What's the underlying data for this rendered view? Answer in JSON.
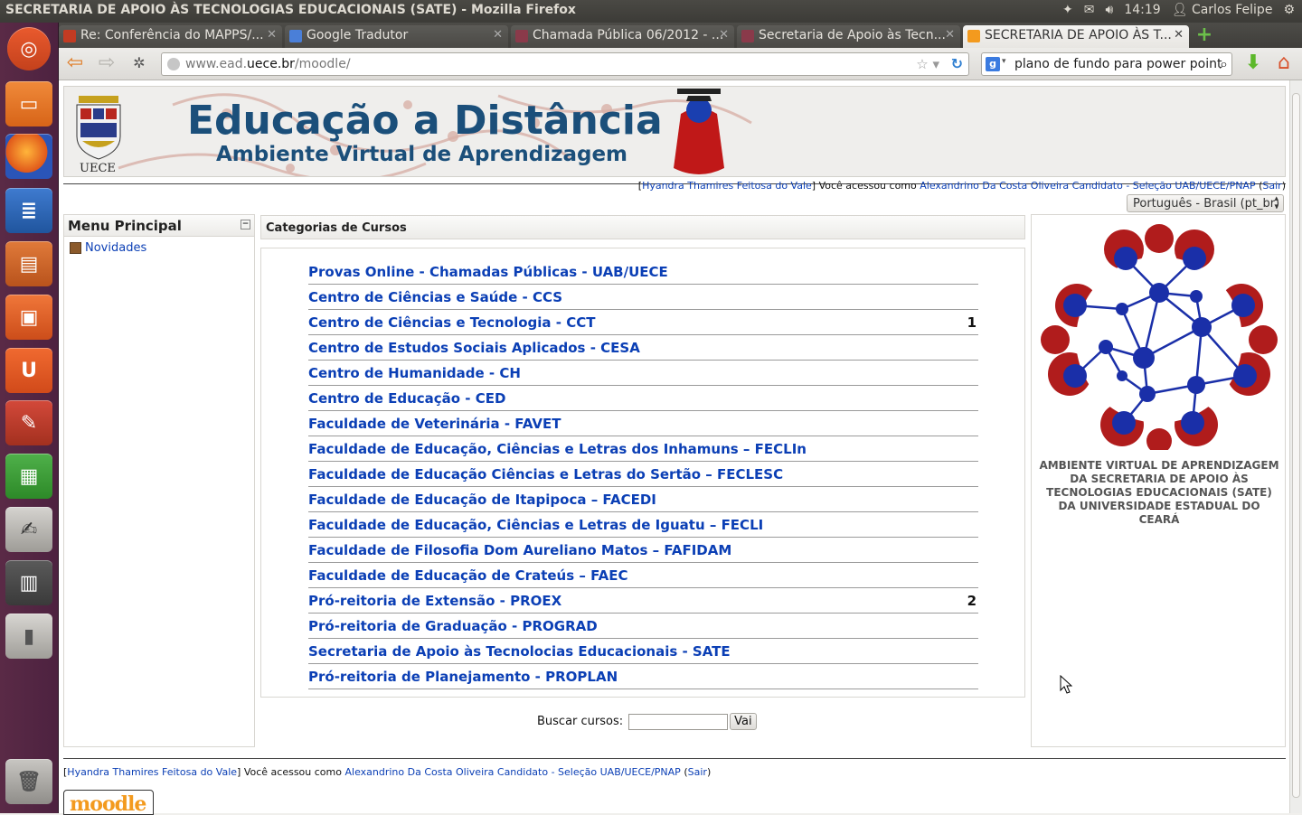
{
  "system": {
    "window_title": "SECRETARIA DE APOIO ÀS TECNOLOGIAS EDUCACIONAIS (SATE) - Mozilla Firefox",
    "clock": "14:19",
    "user": "Carlos Felipe"
  },
  "tabs": [
    {
      "label": "Re: Conferência do MAPPS/...",
      "icon": "gmail-icon",
      "icon_color": "#c23b22"
    },
    {
      "label": "Google Tradutor",
      "icon": "translate-icon",
      "icon_color": "#4a7fd8"
    },
    {
      "label": "Chamada Pública 06/2012 - ...",
      "icon": "moodle-net-icon",
      "icon_color": "#8a3a4a"
    },
    {
      "label": "Secretaria de Apoio às Tecn...",
      "icon": "moodle-net-icon",
      "icon_color": "#8a3a4a"
    },
    {
      "label": "SECRETARIA DE APOIO ÀS T...",
      "icon": "moodle-icon",
      "icon_color": "#f39a1e",
      "active": true
    }
  ],
  "navbar": {
    "url_prefix": "www.ead.",
    "url_host": "uece.br",
    "url_suffix": "/moodle/",
    "search_value": "plano de fundo para power point"
  },
  "header": {
    "title": "Educação a Distância",
    "subtitle": "Ambiente Virtual de Aprendizagem",
    "logo_text": "UECE"
  },
  "login": {
    "user_link": "Hyandra Thamires Feitosa do Vale",
    "mid_text": "Você acessou como",
    "as_link": "Alexandrino Da Costa Oliveira Candidato - Seleção UAB/UECE/PNAP",
    "logout": "Sair"
  },
  "language": {
    "selected": "Português - Brasil (pt_br)"
  },
  "menu": {
    "title": "Menu Principal",
    "toggle": "−",
    "items": [
      {
        "label": "Novidades"
      }
    ]
  },
  "categories": {
    "title": "Categorias de Cursos",
    "items": [
      {
        "label": "Provas Online - Chamadas Públicas - UAB/UECE",
        "count": ""
      },
      {
        "label": "Centro de Ciências e Saúde - CCS",
        "count": ""
      },
      {
        "label": "Centro de Ciências e Tecnologia - CCT",
        "count": "1"
      },
      {
        "label": "Centro de Estudos Sociais Aplicados - CESA",
        "count": ""
      },
      {
        "label": "Centro de Humanidade - CH",
        "count": ""
      },
      {
        "label": "Centro de Educação - CED",
        "count": ""
      },
      {
        "label": "Faculdade de Veterinária - FAVET",
        "count": ""
      },
      {
        "label": "Faculdade de Educação, Ciências e Letras dos Inhamuns – FECLIn",
        "count": ""
      },
      {
        "label": "Faculdade de Educação Ciências e Letras do Sertão – FECLESC",
        "count": ""
      },
      {
        "label": "Faculdade de Educação de Itapipoca – FACEDI",
        "count": ""
      },
      {
        "label": "Faculdade de Educação, Ciências e Letras de Iguatu – FECLI",
        "count": ""
      },
      {
        "label": "Faculdade de Filosofia Dom Aureliano Matos – FAFIDAM",
        "count": ""
      },
      {
        "label": "Faculdade de Educação de Crateús – FAEC",
        "count": ""
      },
      {
        "label": "Pró-reitoria de Extensão - PROEX",
        "count": "2"
      },
      {
        "label": "Pró-reitoria de Graduação - PROGRAD",
        "count": ""
      },
      {
        "label": "Secretaria de Apoio às Tecnolocias Educacionais - SATE",
        "count": ""
      },
      {
        "label": "Pró-reitoria de Planejamento - PROPLAN",
        "count": ""
      }
    ]
  },
  "search": {
    "label": "Buscar cursos:",
    "button": "Vai",
    "value": ""
  },
  "sidebar_right": {
    "caption": "AMBIENTE VIRTUAL DE APRENDIZAGEM DA SECRETARIA DE APOIO ÀS TECNOLOGIAS EDUCACIONAIS (SATE) DA UNIVERSIDADE ESTADUAL DO CEARÁ"
  },
  "footer": {
    "logo_text": "moodle"
  },
  "colors": {
    "link": "#0b3fb5",
    "accent_red": "#b01c1c",
    "accent_blue": "#1a2fa8"
  }
}
